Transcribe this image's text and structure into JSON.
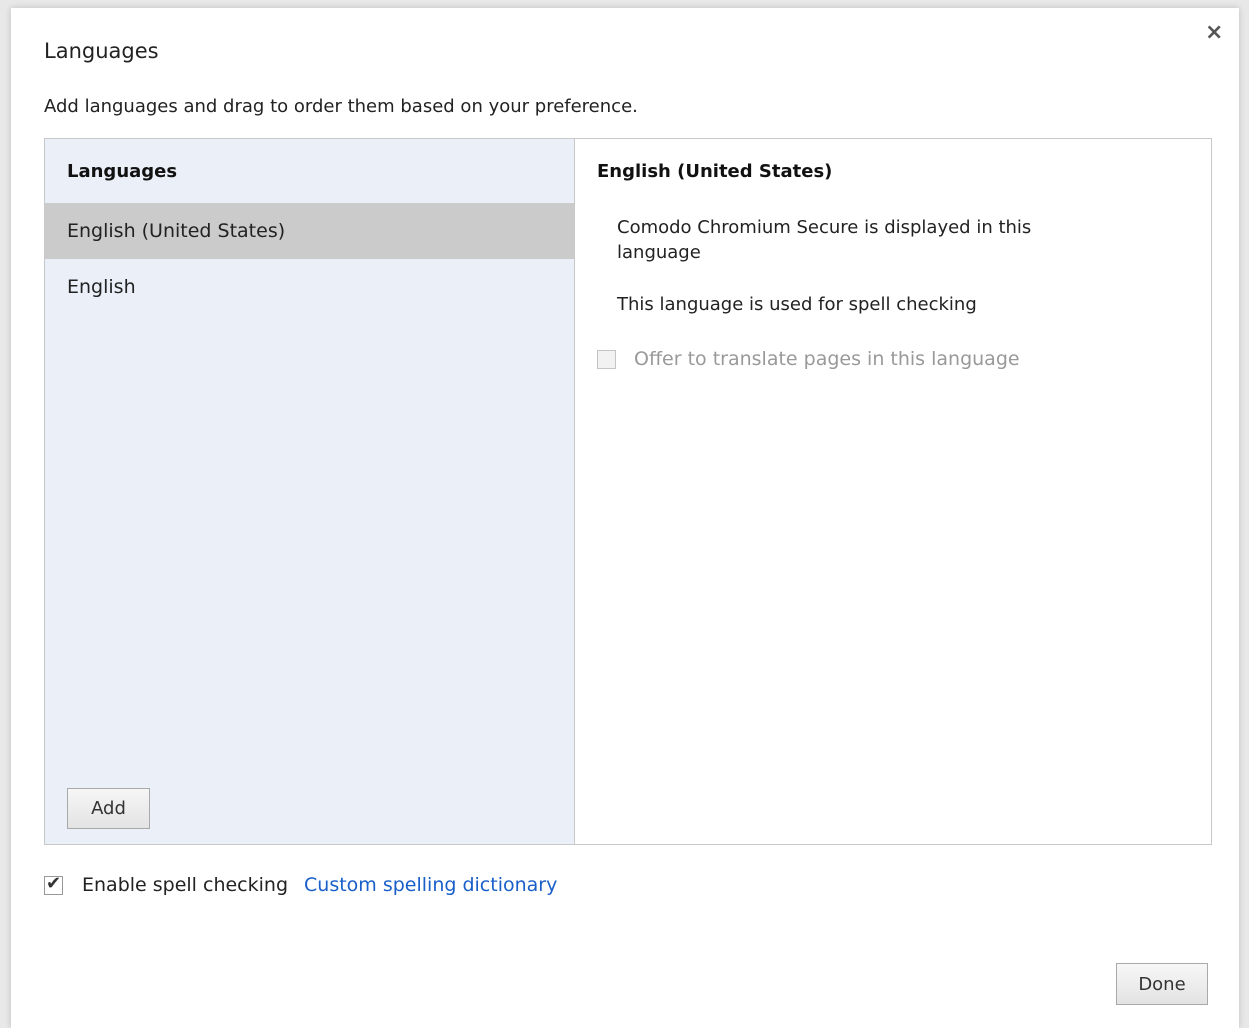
{
  "dialog": {
    "title": "Languages",
    "close_label": "×",
    "subtitle": "Add languages and drag to order them based on your preference."
  },
  "left_pane": {
    "header": "Languages",
    "items": [
      {
        "label": "English (United States)",
        "selected": true
      },
      {
        "label": "English",
        "selected": false
      }
    ],
    "add_label": "Add"
  },
  "right_pane": {
    "header": "English (United States)",
    "display_info": "Comodo Chromium Secure is displayed in this language",
    "spell_info": "This language is used for spell checking",
    "translate_label": "Offer to translate pages in this language",
    "translate_checked": false
  },
  "footer": {
    "spell_label": "Enable spell checking",
    "spell_checked": true,
    "dictionary_link": "Custom spelling dictionary",
    "done_label": "Done"
  },
  "colors": {
    "left_pane_bg": "#ebf0f8",
    "selected_item_bg": "#cbcbcb",
    "link": "#1a5fc9"
  }
}
